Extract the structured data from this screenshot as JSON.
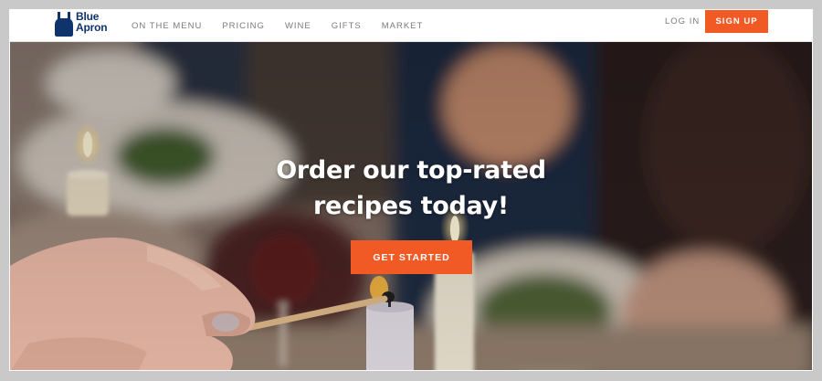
{
  "brand": {
    "line1": "Blue",
    "line2": "Apron",
    "color": "#0f346c"
  },
  "nav": {
    "items": [
      {
        "label": "ON THE MENU"
      },
      {
        "label": "PRICING"
      },
      {
        "label": "WINE"
      },
      {
        "label": "GIFTS"
      },
      {
        "label": "MARKET"
      }
    ],
    "login_label": "LOG IN",
    "signup_label": "SIGN UP"
  },
  "hero": {
    "headline_line1": "Order our top-rated",
    "headline_line2": "recipes today!",
    "cta_label": "GET STARTED",
    "image": "dinner-table-candle-lighting-photo"
  },
  "colors": {
    "accent": "#f15a24",
    "nav_text": "#7b7b7b",
    "header_bg": "#ffffff"
  }
}
